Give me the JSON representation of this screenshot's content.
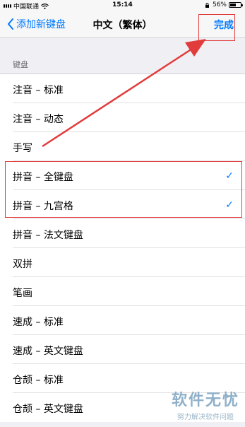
{
  "status_bar": {
    "carrier": "中国联通",
    "time": "15:14",
    "battery": "56%",
    "battery_level": 0.56
  },
  "nav": {
    "back_label": "添加新键盘",
    "title": "中文（繁体）",
    "done_label": "完成"
  },
  "section": {
    "header": "键盘"
  },
  "keyboards": [
    {
      "label": "注音 – 标准",
      "checked": false
    },
    {
      "label": "注音 – 动态",
      "checked": false
    },
    {
      "label": "手写",
      "checked": false
    },
    {
      "label": "拼音 – 全键盘",
      "checked": true
    },
    {
      "label": "拼音 – 九宫格",
      "checked": true
    },
    {
      "label": "拼音 – 法文键盘",
      "checked": false
    },
    {
      "label": "双拼",
      "checked": false
    },
    {
      "label": "笔画",
      "checked": false
    },
    {
      "label": "速成 – 标准",
      "checked": false
    },
    {
      "label": "速成 – 英文键盘",
      "checked": false
    },
    {
      "label": "仓颉 – 标准",
      "checked": false
    },
    {
      "label": "仓颉 – 英文键盘",
      "checked": false
    }
  ],
  "watermark": {
    "title": "软件无忧",
    "subtitle": "努力解决软件问题"
  },
  "colors": {
    "accent": "#007aff",
    "annotation": "#e23b3b"
  }
}
